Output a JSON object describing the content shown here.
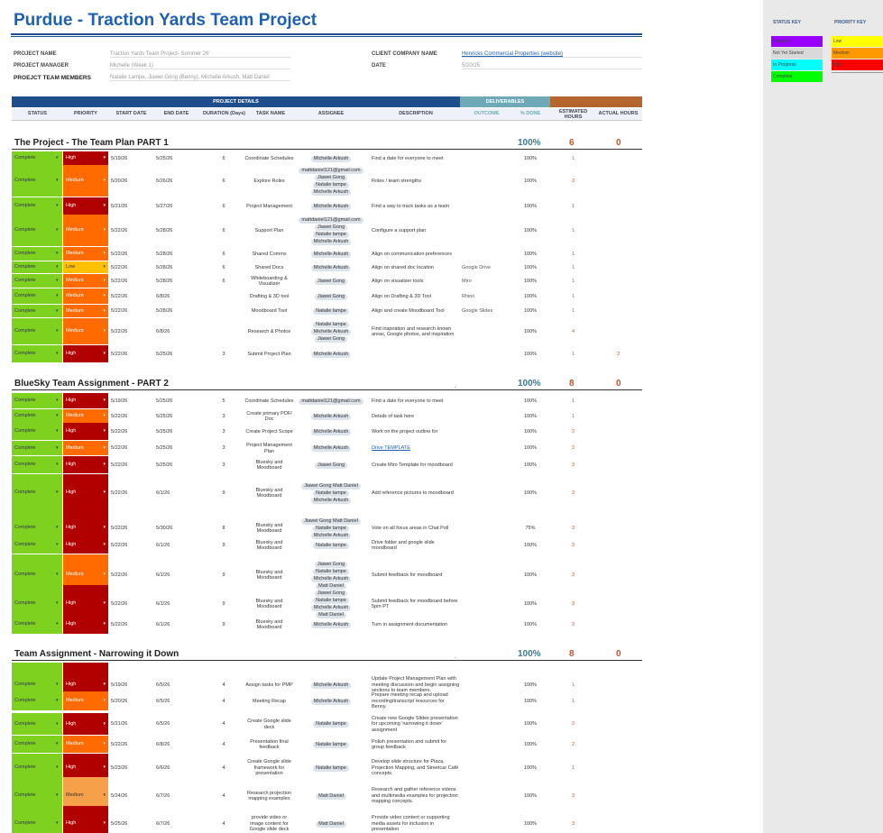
{
  "title": "Purdue - Traction Yards Team Project",
  "info": {
    "project_name_label": "PROJECT NAME",
    "project_name": "Traction Yards Team Project- Summer 26'",
    "project_manager_label": "PROJECT MANAGER",
    "project_manager": "Michelle (Week 1)",
    "team_label": "PROEJCT TEAM MEMBERS",
    "team": "Natalie Lampe, Jiawei Gong (Benny), Michelle Arkush, Matt Daniel",
    "client_label": "CLIENT COMPANY NAME",
    "client": "Henricks Commercial Properties (website)",
    "date_label": "DATE",
    "date": "5/20/25"
  },
  "bars": {
    "details": "PROJECT DETAILS",
    "deliverables": "DELIVERABLES"
  },
  "columns": [
    "STATUS",
    "PRIORITY",
    "START DATE",
    "END DATE",
    "DURATION (Days)",
    "TASK NAME",
    "ASSIGNEE",
    "DESCRIPTION",
    "OUTCOME",
    "% DONE",
    "ESTIMATED HOURS",
    "ACTUAL HOURS"
  ],
  "sections": [
    {
      "title": "The Project - The Team Plan  PART 1",
      "pct": "100%",
      "est": "6",
      "act": "0",
      "rows": [
        {
          "status": "Complete",
          "priority": "High",
          "start": "5/19/26",
          "end": "5/25/26",
          "dur": "6",
          "task": "Coordinate Schedules",
          "assignees": [
            "Michelle Arkush"
          ],
          "desc": "Find a date for everyone to meet",
          "outcome": "",
          "done": "100%",
          "est": "1",
          "act": ""
        },
        {
          "status": "Complete",
          "priority": "Medium",
          "start": "5/20/26",
          "end": "5/26/26",
          "dur": "6",
          "task": "Explore Roles",
          "assignees": [
            "mattdaniel121@gmail.com",
            "Jiawei Gong",
            "Natalie lampe",
            "Michelle Arkush"
          ],
          "desc": "Roles / team strengths",
          "outcome": "",
          "done": "100%",
          "est": "3",
          "act": ""
        },
        {
          "status": "Complete",
          "priority": "High",
          "start": "5/21/26",
          "end": "5/27/26",
          "dur": "6",
          "task": "Project Management",
          "assignees": [
            "Michelle Arkush"
          ],
          "desc": "Find a way to track tasks as a team",
          "outcome": "",
          "done": "100%",
          "est": "1",
          "act": ""
        },
        {
          "status": "Complete",
          "priority": "Medium",
          "start": "5/22/26",
          "end": "5/28/26",
          "dur": "6",
          "task": "Support Plan",
          "assignees": [
            "mattdaniel121@gmail.com",
            "Jiawei Gong",
            "Natalie lampe",
            "Michelle Arkush"
          ],
          "desc": "Configure a support plan",
          "outcome": "",
          "done": "100%",
          "est": "1",
          "act": ""
        },
        {
          "status": "Complete",
          "priority": "Medium",
          "start": "5/22/26",
          "end": "5/28/26",
          "dur": "6",
          "task": "Shared Comms",
          "assignees": [
            "Michelle Arkush"
          ],
          "desc": "Align on communication preferences",
          "outcome": "",
          "done": "100%",
          "est": "1",
          "act": ""
        },
        {
          "status": "Complete",
          "priority": "Low",
          "start": "5/22/26",
          "end": "5/28/26",
          "dur": "6",
          "task": "Shared Docs",
          "assignees": [
            "Michelle Arkush"
          ],
          "desc": "Align on shared doc location",
          "outcome": "Google Drive",
          "done": "100%",
          "est": "1",
          "act": ""
        },
        {
          "status": "Complete",
          "priority": "Medium",
          "start": "5/22/26",
          "end": "5/28/26",
          "dur": "6",
          "task": "Whiteboarding & Visualizer",
          "assignees": [
            "Jiawei Gong"
          ],
          "desc": "Align on visualizer tools",
          "outcome": "Miro",
          "done": "100%",
          "est": "1",
          "act": ""
        },
        {
          "status": "Complete",
          "priority": "Medium",
          "start": "5/22/26",
          "end": "6/8/26",
          "dur": "",
          "task": "Drafting & 3D tool",
          "assignees": [
            "Jiawei Gong"
          ],
          "desc": "Align on Drafting & 3D Tool",
          "outcome": "Rhino",
          "done": "100%",
          "est": "1",
          "act": ""
        },
        {
          "status": "Complete",
          "priority": "Medium",
          "start": "5/22/26",
          "end": "5/28/26",
          "dur": "",
          "task": "Moodboard Tool",
          "assignees": [
            "Natalie lampe"
          ],
          "desc": "Align and create Moodboard Tool",
          "outcome": "Google Slides",
          "done": "100%",
          "est": "1",
          "act": ""
        },
        {
          "status": "Complete",
          "priority": "Medium",
          "start": "5/22/26",
          "end": "6/8/26",
          "dur": "",
          "task": "Research & Photos",
          "assignees": [
            "Natalie lampe",
            "Michelle Arkush",
            "Jiawei Gong"
          ],
          "desc": "Find inspiration and research known areas, Google photos, and inspiration",
          "outcome": "",
          "done": "100%",
          "est": "4",
          "act": ""
        },
        {
          "status": "Complete",
          "priority": "High",
          "start": "5/22/26",
          "end": "5/25/26",
          "dur": "3",
          "task": "Submit Project Plan",
          "assignees": [
            "Michelle Arkush"
          ],
          "desc": "",
          "outcome": "",
          "done": "100%",
          "est": "1",
          "act": "2"
        }
      ]
    },
    {
      "title": "BlueSky Team Assignment - PART 2",
      "pct": "100%",
      "est": "8",
      "act": "0",
      "rows": [
        {
          "status": "Complete",
          "priority": "High",
          "start": "5/19/26",
          "end": "5/25/26",
          "dur": "5",
          "task": "Coordinate Schedules",
          "assignees": [
            "mattdaniel121@gmail.com"
          ],
          "desc": "Find a date for everyone to meet",
          "outcome": "",
          "done": "100%",
          "est": "1",
          "act": ""
        },
        {
          "status": "Complete",
          "priority": "Medium",
          "start": "5/22/26",
          "end": "5/25/26",
          "dur": "3",
          "task": "Create primary PDF/ Doc",
          "assignees": [
            "Michelle Arkush"
          ],
          "desc": "Details of task here",
          "outcome": "",
          "done": "100%",
          "est": "1",
          "act": ""
        },
        {
          "status": "Complete",
          "priority": "High",
          "start": "5/22/26",
          "end": "5/25/26",
          "dur": "3",
          "task": "Create Project Scope",
          "assignees": [
            "Michelle Arkush"
          ],
          "desc": "Work on the project outline for",
          "outcome": "",
          "done": "100%",
          "est": "2",
          "act": ""
        },
        {
          "status": "Complete",
          "priority": "Medium",
          "start": "5/22/26",
          "end": "5/25/26",
          "dur": "3",
          "task": "Project Management Plan",
          "assignees": [
            "Michelle Arkush"
          ],
          "desc": "Drive TEMPLATE",
          "outcome": "",
          "done": "100%",
          "est": "2",
          "act": ""
        },
        {
          "status": "Complete",
          "priority": "High",
          "start": "5/22/26",
          "end": "5/25/26",
          "dur": "3",
          "task": "Bluesky and Moodboard",
          "assignees": [
            "Jiawei Gong"
          ],
          "desc": "Create Miro Template for moodboard",
          "outcome": "",
          "done": "100%",
          "est": "3",
          "act": ""
        },
        {
          "status": "Complete",
          "priority": "High",
          "start": "5/22/26",
          "end": "6/1/26",
          "dur": "9",
          "task": "Bluesky and Moodboard",
          "assignees": [
            "Jiawei Gong  Matt Daniel",
            "Natalie lampe",
            "Michelle Arkush"
          ],
          "desc": "Add reference pictures to moodboard",
          "outcome": "",
          "done": "100%",
          "est": "3",
          "act": ""
        },
        {
          "status": "Complete",
          "priority": "High",
          "start": "5/22/26",
          "end": "5/30/26",
          "dur": "8",
          "task": "Bluesky and Moodboard",
          "assignees": [
            "Jiawei Gong  Matt Daniel",
            "Natalie lampe",
            "Michelle Arkush"
          ],
          "desc": "Vote on all focus areas in Chat Poll",
          "outcome": "",
          "done": "75%",
          "est": "3",
          "act": ""
        },
        {
          "status": "Complete",
          "priority": "High",
          "start": "5/22/26",
          "end": "6/1/26",
          "dur": "9",
          "task": "Bluesky and Moodboard",
          "assignees": [
            "Natalie lampe"
          ],
          "desc": "Drive folder and google slide moodboard",
          "outcome": "",
          "done": "100%",
          "est": "3",
          "act": ""
        },
        {
          "status": "Complete",
          "priority": "Medium",
          "start": "5/22/26",
          "end": "6/1/26",
          "dur": "9",
          "task": "Bluesky and Moodboard",
          "assignees": [
            "Jiawei Gong",
            "Natalie lampe",
            "Michelle Arkush",
            "Matt Daniel"
          ],
          "desc": "Submit feedback for moodboard",
          "outcome": "",
          "done": "100%",
          "est": "3",
          "act": ""
        },
        {
          "status": "Complete",
          "priority": "High",
          "start": "5/22/26",
          "end": "6/1/26",
          "dur": "9",
          "task": "Bluesky and Moodboard",
          "assignees": [
            "Jiawei Gong",
            "Natalie lampe",
            "Michelle Arkush",
            "Matt Daniel"
          ],
          "desc": "Submit feedback for moodboard before 5pm PT",
          "outcome": "",
          "done": "100%",
          "est": "3",
          "act": ""
        },
        {
          "status": "Complete",
          "priority": "High",
          "start": "5/22/26",
          "end": "6/1/26",
          "dur": "9",
          "task": "Bluesky and Moodboard",
          "assignees": [
            "Michelle Arkush"
          ],
          "desc": "Turn in assignment documentation",
          "outcome": "",
          "done": "100%",
          "est": "3",
          "act": ""
        }
      ]
    },
    {
      "title": "Team Assignment - Narrowing it Down",
      "pct": "100%",
      "est": "8",
      "act": "0",
      "rows": [
        {
          "status": "Complete",
          "priority": "High",
          "start": "5/19/26",
          "end": "6/5/26",
          "dur": "4",
          "task": "Assign tasks for PMP",
          "assignees": [
            "Michelle Arkush"
          ],
          "desc": "Update Project Management Plan with meeting discussion and begin assigning sections to team members.",
          "outcome": "",
          "done": "100%",
          "est": "1",
          "act": ""
        },
        {
          "status": "Complete",
          "priority": "Medium",
          "start": "5/20/26",
          "end": "6/5/26",
          "dur": "4",
          "task": "Meeting Recap",
          "assignees": [
            "Michelle Arkush"
          ],
          "desc": "Prepare meeting recap and upload recording/transcript resources for Benny.",
          "outcome": "",
          "done": "100%",
          "est": "1",
          "act": ""
        },
        {
          "status": "Complete",
          "priority": "High",
          "start": "5/21/26",
          "end": "6/5/26",
          "dur": "4",
          "task": "Create Google slide deck",
          "assignees": [
            "Natalie lampe"
          ],
          "desc": "Create new Google Slides presentation for upcoming 'narrowing it down' assignment",
          "outcome": "",
          "done": "100%",
          "est": "2",
          "act": ""
        },
        {
          "status": "Complete",
          "priority": "Medium",
          "start": "5/22/26",
          "end": "6/8/26",
          "dur": "4",
          "task": "Presentation final feedback",
          "assignees": [
            "Natalie lampe"
          ],
          "desc": "Polish presentation and submit for group feedback",
          "outcome": "",
          "done": "100%",
          "est": "2",
          "act": ""
        },
        {
          "status": "Complete",
          "priority": "High",
          "start": "5/23/26",
          "end": "6/6/26",
          "dur": "4",
          "task": "Create Google slide framework for presentation",
          "assignees": [
            "Natalie lampe"
          ],
          "desc": "Develop slide structure for Plaza, Projection Mapping, and Streetcar Café concepts.",
          "outcome": "",
          "done": "100%",
          "est": "1",
          "act": ""
        },
        {
          "status": "Complete",
          "priority": "Medium",
          "start": "5/24/26",
          "end": "6/7/26",
          "dur": "4",
          "task": "Research projection mapping examples",
          "assignees": [
            "Matt Daniel"
          ],
          "desc": "Research and gather reference videos and multimedia examples for projection mapping concepts.",
          "outcome": "",
          "done": "100%",
          "est": "3",
          "act": ""
        },
        {
          "status": "Complete",
          "priority": "High",
          "start": "5/25/26",
          "end": "6/7/26",
          "dur": "4",
          "task": "provide video or image content for Google slide deck",
          "assignees": [
            "Matt Daniel"
          ],
          "desc": "Provide video content or supporting media assets for inclusion in presentation",
          "outcome": "",
          "done": "100%",
          "est": "3",
          "act": ""
        }
      ]
    }
  ],
  "key": {
    "status_title": "STATUS KEY",
    "priority_title": "PRIORITY KEY",
    "status": [
      {
        "label": "Overdue",
        "color": "#9900ff"
      },
      {
        "label": "Not Yet Started",
        "color": "#d9d9d9"
      },
      {
        "label": "In Progress",
        "color": "#00ffff"
      },
      {
        "label": "Complete",
        "color": "#00ff00"
      }
    ],
    "priority": [
      {
        "label": "Low",
        "color": "#ffff00"
      },
      {
        "label": "Medium",
        "color": "#ff9900"
      },
      {
        "label": "High",
        "color": "#ff0000"
      }
    ]
  },
  "colors": {
    "header_blue": "#1f5fb4",
    "deliverables_teal": "#6fa8b6",
    "hours_orange": "#c0552e",
    "complete_green": "#7ed11f"
  }
}
